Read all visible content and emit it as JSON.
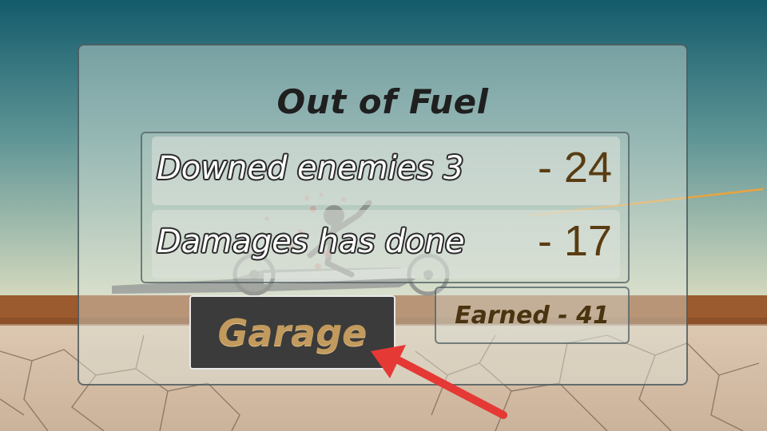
{
  "result": {
    "title": "Out of Fuel",
    "stats": [
      {
        "label": "Downed enemies 3",
        "value": "- 24"
      },
      {
        "label": "Damages has done",
        "value": "- 17"
      }
    ],
    "earned": "Earned - 41",
    "garage_button": "Garage"
  },
  "colors": {
    "sky_top": "#135b6b",
    "sky_bottom": "#cfd7bd",
    "ground_dirt": "#9c5b2e",
    "ground_cracked": "#d7c2ac",
    "value_text": "#5a3c12",
    "garage_button_bg": "#3b3b3b",
    "garage_text": "#c29a5d",
    "arrow": "#e53935"
  },
  "icons": {
    "hint_arrow": "red-pointer-arrow",
    "vehicle": "stickman-vehicle"
  }
}
